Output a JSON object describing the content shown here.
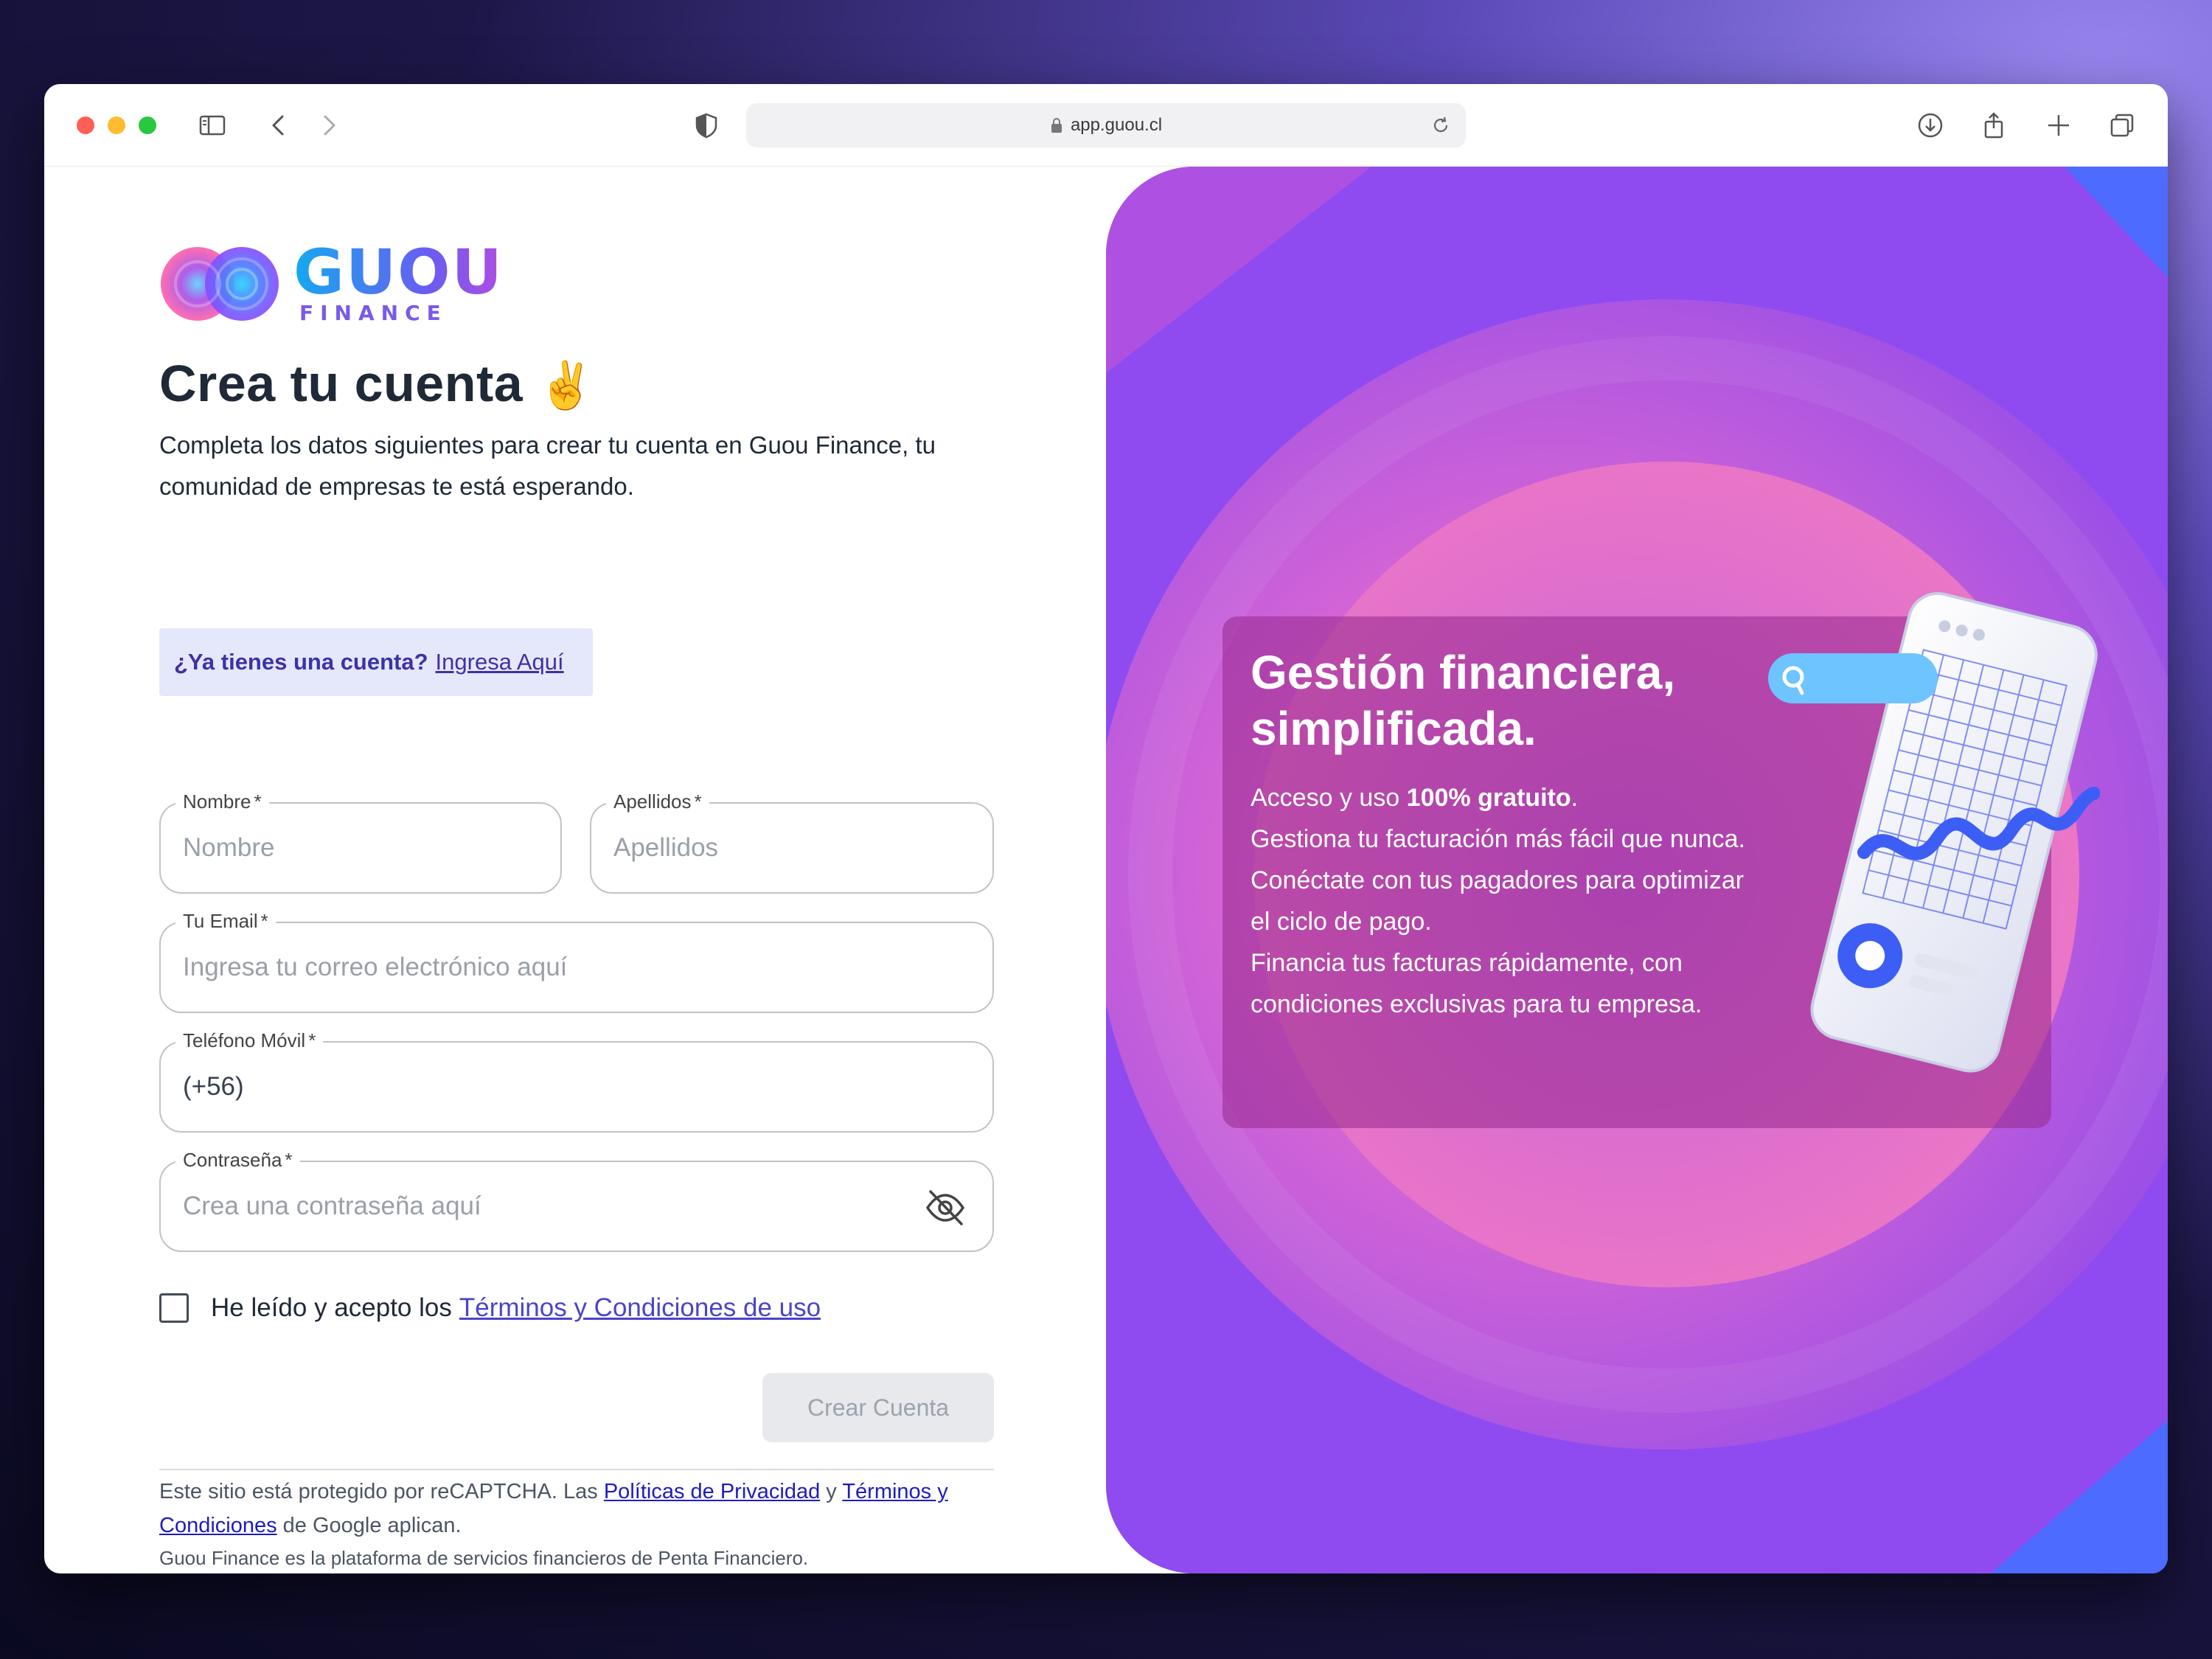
{
  "browser": {
    "url": "app.guou.cl"
  },
  "brand": {
    "name": "GUOU",
    "sub": "FINANCE"
  },
  "signup": {
    "title": "Crea tu cuenta",
    "title_emoji": "✌️",
    "subtitle": "Completa los datos siguientes para crear tu cuenta en Guou Finance, tu comunidad de empresas te está esperando.",
    "login_question": "¿Ya tienes una cuenta?",
    "login_link": "Ingresa Aquí"
  },
  "form": {
    "nombre": {
      "label": "Nombre",
      "required": "*",
      "placeholder": "Nombre"
    },
    "apellidos": {
      "label": "Apellidos",
      "required": "*",
      "placeholder": "Apellidos"
    },
    "email": {
      "label": "Tu Email",
      "required": "*",
      "placeholder": "Ingresa tu correo electrónico aquí"
    },
    "telefono": {
      "label": "Teléfono Móvil",
      "required": "*",
      "value": "(+56)"
    },
    "password": {
      "label": "Contraseña",
      "required": "*",
      "placeholder": "Crea una contraseña aquí"
    },
    "terms_text": "He leído y acepto los",
    "terms_link": "Términos y Condiciones de uso",
    "submit_label": "Crear Cuenta"
  },
  "legal": {
    "recaptcha_prefix": "Este sitio está protegido por reCAPTCHA. Las",
    "privacy_link": "Políticas de Privacidad",
    "and": "y",
    "terms_link": "Términos y Condiciones",
    "recaptcha_suffix": "de Google aplican.",
    "footer": "Guou Finance es la plataforma de servicios financieros de Penta Financiero."
  },
  "promo": {
    "title": "Gestión financiera, simplificada.",
    "line1_prefix": "Acceso y uso",
    "line1_bold": "100% gratuito",
    "line1_suffix": ".",
    "line2": "Gestiona tu facturación más fácil que nunca.",
    "line3": "Conéctate con tus pagadores para optimizar el ciclo de pago.",
    "line4": "Financia tus facturas rápidamente, con condiciones exclusivas para tu empresa."
  },
  "icons": {
    "sidebar": "sidebar-icon",
    "back": "chevron-left-icon",
    "forward": "chevron-right-icon",
    "shield": "shield-icon",
    "lock": "lock-icon",
    "reload": "reload-icon",
    "download": "download-icon",
    "share": "share-icon",
    "new_tab": "plus-icon",
    "tabs": "tabs-icon",
    "eye_off": "eye-off-icon"
  },
  "colors": {
    "brand_purple": "#3b33a6",
    "link": "#4b44c9",
    "panel_start": "#a24fe0",
    "panel_end": "#6d48ee"
  }
}
